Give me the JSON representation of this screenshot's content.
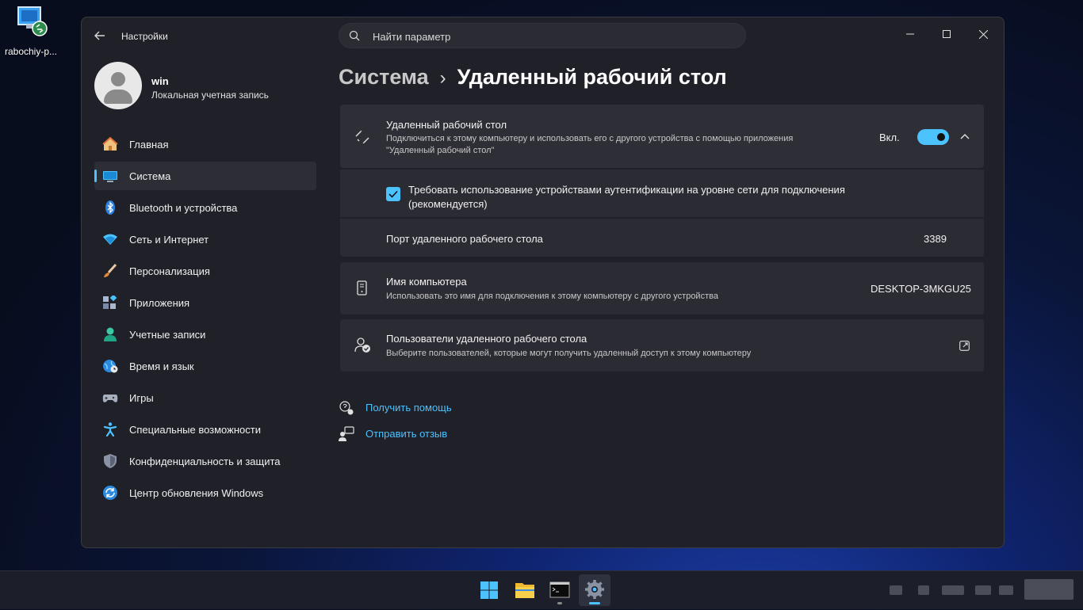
{
  "desktop": {
    "icon_label": "rabochiy-p..."
  },
  "window": {
    "title": "Настройки",
    "controls": {
      "minimize": "—",
      "maximize": "☐",
      "close": "✕"
    }
  },
  "search": {
    "placeholder": "Найти параметр"
  },
  "profile": {
    "name": "win",
    "type": "Локальная учетная запись"
  },
  "sidebar": {
    "items": [
      {
        "label": "Главная",
        "icon": "home-icon",
        "active": false
      },
      {
        "label": "Система",
        "icon": "monitor-icon",
        "active": true
      },
      {
        "label": "Bluetooth и устройства",
        "icon": "bluetooth-icon",
        "active": false
      },
      {
        "label": "Сеть и Интернет",
        "icon": "wifi-icon",
        "active": false
      },
      {
        "label": "Персонализация",
        "icon": "brush-icon",
        "active": false
      },
      {
        "label": "Приложения",
        "icon": "apps-icon",
        "active": false
      },
      {
        "label": "Учетные записи",
        "icon": "person-icon",
        "active": false
      },
      {
        "label": "Время и язык",
        "icon": "globe-clock-icon",
        "active": false
      },
      {
        "label": "Игры",
        "icon": "gamepad-icon",
        "active": false
      },
      {
        "label": "Специальные возможности",
        "icon": "accessibility-icon",
        "active": false
      },
      {
        "label": "Конфиденциальность и защита",
        "icon": "shield-icon",
        "active": false
      },
      {
        "label": "Центр обновления Windows",
        "icon": "update-icon",
        "active": false
      }
    ]
  },
  "breadcrumb": {
    "parent": "Система",
    "separator": "›",
    "current": "Удаленный рабочий стол"
  },
  "rdp": {
    "title": "Удаленный рабочий стол",
    "description_line1": "Подключиться к этому компьютеру и использовать его с другого устройства с помощью приложения",
    "description_line2": "\"Удаленный рабочий стол\"",
    "state_label": "Вкл.",
    "enabled": true,
    "nla_label_line1": "Требовать использование устройствами аутентификации на уровне сети для подключения",
    "nla_label_line2": "(рекомендуется)",
    "nla_checked": true,
    "port_label": "Порт удаленного рабочего стола",
    "port_value": "3389"
  },
  "pc_name": {
    "title": "Имя компьютера",
    "description": "Использовать это имя для подключения к этому компьютеру с другого устройства",
    "value": "DESKTOP-3MKGU25"
  },
  "rdp_users": {
    "title": "Пользователи удаленного рабочего стола",
    "description": "Выберите пользователей, которые могут получить удаленный доступ к этому компьютеру"
  },
  "links": {
    "help": "Получить помощь",
    "feedback": "Отправить отзыв"
  },
  "colors": {
    "accent": "#4cc2ff",
    "window_bg": "#202028",
    "card_bg": "#2b2b33"
  }
}
